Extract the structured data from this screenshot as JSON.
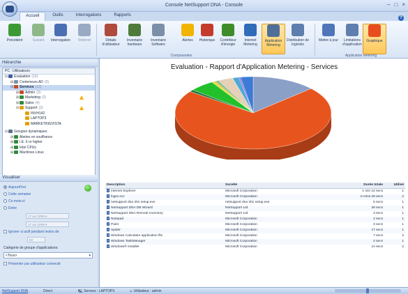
{
  "window": {
    "title": "Console NetSupport DNA - Console"
  },
  "menu_tabs": [
    "Accueil",
    "Outils",
    "Interrogations",
    "Rapports"
  ],
  "ribbon": {
    "buttons": [
      {
        "label": "Précédent",
        "icon": "back-arrow-icon",
        "color": "#3c9a34"
      },
      {
        "label": "Suivant",
        "icon": "forward-arrow-icon",
        "color": "#8fb889"
      },
      {
        "label": "Interrogation",
        "icon": "query-icon",
        "color": "#4b6fb3"
      },
      {
        "label": "Rebond",
        "icon": "rebound-icon",
        "color": "#9aaac4"
      },
      {
        "label": "Détails d'utilisateur",
        "icon": "user-details-icon",
        "color": "#b04a3a"
      },
      {
        "label": "Inventaire hardware",
        "icon": "hardware-inventory-icon",
        "color": "#4e7a3a"
      },
      {
        "label": "Inventaire Software",
        "icon": "software-inventory-icon",
        "color": "#7b8fa8"
      },
      {
        "label": "Alertes",
        "icon": "bell-icon",
        "color": "#f2b400"
      },
      {
        "label": "Historique",
        "icon": "calendar-icon",
        "color": "#c43b2b"
      },
      {
        "label": "Contrôleur d'énergie",
        "icon": "power-icon",
        "color": "#3f8d2a"
      },
      {
        "label": "Internet Metering",
        "icon": "globe-icon",
        "color": "#2f6db8"
      },
      {
        "label": "Application Metering",
        "icon": "application-metering-icon",
        "color": "#4f6f9a"
      },
      {
        "label": "Distribution de logiciels",
        "icon": "software-distribution-icon",
        "color": "#5e7fae"
      },
      {
        "label": "Mettre à jour",
        "icon": "refresh-icon",
        "color": "#4e76b8"
      },
      {
        "label": "Limitations d'application",
        "icon": "limitations-icon",
        "color": "#5f7fae"
      },
      {
        "label": "Graphique",
        "icon": "chart-icon",
        "color": "#e84d1f"
      }
    ],
    "group_labels": {
      "components": "Composantes",
      "metering": "Application Metering"
    }
  },
  "left": {
    "hierarchy_header": "Hiérarchie",
    "tree_title": "PC : Utilisateurs",
    "tree": [
      {
        "label": "Evaluation",
        "count": "(12)",
        "indent": 0,
        "exp": "⊟",
        "color": "#3a5f9a"
      },
      {
        "label": "Conteneurs AD",
        "count": "(0)",
        "indent": 1,
        "exp": "⊞",
        "color": "#7d8fa9"
      },
      {
        "label": "Services",
        "count": "(12)",
        "indent": 1,
        "exp": "⊟",
        "color": "#c44b2b",
        "selected": true
      },
      {
        "label": "Admin",
        "count": "(3)",
        "indent": 2,
        "exp": "⊞",
        "color": "#c44b2b"
      },
      {
        "label": "Marketing",
        "count": "(2)",
        "indent": 2,
        "exp": "⊞",
        "color": "#2f8b38",
        "warn": true
      },
      {
        "label": "Sales",
        "count": "(4)",
        "indent": 2,
        "exp": "⊞",
        "color": "#2f8b38"
      },
      {
        "label": "Support",
        "count": "(3)",
        "indent": 2,
        "exp": "⊟",
        "color": "#e3a000",
        "warn": true
      },
      {
        "label": "INVH142",
        "count": "",
        "indent": 3,
        "exp": "",
        "color": "#e3a000"
      },
      {
        "label": "LAPTOP3",
        "count": "",
        "indent": 3,
        "exp": "",
        "color": "#e3a000"
      },
      {
        "label": "MARKETINGVISTA",
        "count": "",
        "indent": 3,
        "exp": "",
        "color": "#e3a000"
      }
    ],
    "tree2": [
      {
        "label": "Groupes dynamiques",
        "indent": 0,
        "exp": "⊟",
        "color": "#5c6f8e"
      },
      {
        "label": "Alertes en souffrance",
        "indent": 1,
        "exp": "⊞",
        "color": "#2f8b38"
      },
      {
        "label": "I.E. 6 or higher",
        "indent": 1,
        "exp": "⊞",
        "color": "#2f8b38"
      },
      {
        "label": "Intel CPUs",
        "indent": 1,
        "exp": "⊞",
        "color": "#2f8b38"
      },
      {
        "label": "Machines Linux",
        "indent": 1,
        "exp": "⊞",
        "color": "#2f8b38"
      }
    ],
    "view_header": "Visualiser",
    "filter": {
      "options": [
        "Aujourd'hui",
        "Cette semaine",
        "Ce mois-ci",
        "Entre"
      ],
      "date_from": "17 avr 2009",
      "date_to": "17 avr 2009",
      "ignore_label": "Ignorer si actif pendant moins de",
      "ignore_value": "60",
      "category_label": "Catégorie de groupe d'applications:",
      "category_value": "<Tous>",
      "per_user_label": "Présenter par utilisateur connecté"
    }
  },
  "report": {
    "title": "Evaluation - Rapport d'Application Metering - Services",
    "columns": [
      "Description",
      "Société",
      "Durée totale",
      "Utilisé"
    ],
    "rows": [
      [
        "Internet Explorer",
        "Microsoft Corporation",
        "1 min 12 secs",
        "1"
      ],
      [
        "logon.scr",
        "Microsoft Corporation",
        "6 mins 28 secs",
        "2"
      ],
      [
        "netsupport dna 301 setup.exe",
        "netsupport dna 301 setup.exe",
        "5 secs",
        "1"
      ],
      [
        "NetSupport DNA DB Wizard",
        "NetSupport Ltd",
        "28 secs",
        "1"
      ],
      [
        "NetSupport DNA Remote Inventory",
        "NetSupport Ltd",
        "3 secs",
        "1"
      ],
      [
        "Notepad",
        "Microsoft Corporation",
        "2 secs",
        "1"
      ],
      [
        "Paint",
        "Microsoft Corporation",
        "3 secs",
        "1"
      ],
      [
        "Spider",
        "Microsoft Corporation",
        "17 secs",
        "1"
      ],
      [
        "Windows Calculator application file",
        "Microsoft Corporation",
        "7 secs",
        "2"
      ],
      [
        "Windows TaskManager",
        "Microsoft Corporation",
        "2 secs",
        "1"
      ],
      [
        "Windows® installer",
        "Microsoft Corporation",
        "14 secs",
        "2"
      ]
    ]
  },
  "chart_data": {
    "type": "pie",
    "categories": [
      "Internet Explorer",
      "logon.scr",
      "netsupport dna 301 setup.exe",
      "NetSupport DNA DB Wizard",
      "NetSupport DNA Remote Inventory",
      "Notepad",
      "Paint",
      "Spider",
      "Windows Calculator application file",
      "Windows TaskManager",
      "Windows® installer"
    ],
    "values": [
      72,
      388,
      5,
      28,
      3,
      2,
      3,
      17,
      7,
      2,
      14
    ],
    "colors": [
      "#8ba0c6",
      "#e8541e",
      "#1f7a3a",
      "#22c02b",
      "#d7e42a",
      "#f0a43a",
      "#6fbf8a",
      "#e6d0b8",
      "#4fa9d6",
      "#8b6be0",
      "#3d7bd5"
    ]
  },
  "status": {
    "product": "NetSupport DNA",
    "mode": "Direct",
    "server": "Serveur : LAPTOP3",
    "user": "Utilisateur : admin"
  }
}
